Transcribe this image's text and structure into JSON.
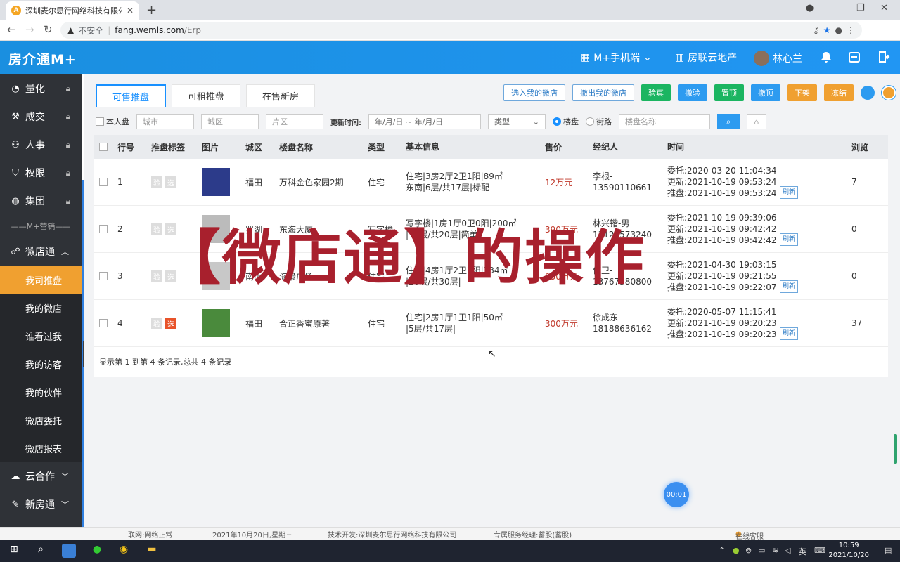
{
  "browser": {
    "tab_title": "深圳麦尔思行网络科技有限公司",
    "new_tab": "+",
    "insecure_label": "不安全",
    "url_host": "fang.wemls.com",
    "url_path": "/Erp"
  },
  "header": {
    "logo": "房介通M+",
    "mobile": "M+手机端",
    "cloud": "房联云地产",
    "user": "林心兰"
  },
  "sidebar": {
    "items": [
      {
        "label": "量化",
        "icon": "chart-pie-icon"
      },
      {
        "label": "成交",
        "icon": "hammer-icon"
      },
      {
        "label": "人事",
        "icon": "people-icon"
      },
      {
        "label": "权限",
        "icon": "shield-icon"
      },
      {
        "label": "集团",
        "icon": "globe-icon"
      }
    ],
    "divider": "M+营销",
    "micro_store": "微店通",
    "subitems": [
      "我司推盘",
      "我的微店",
      "谁看过我",
      "我的访客",
      "我的伙伴",
      "微店委托",
      "微店报表"
    ],
    "cloud": "云合作",
    "newhouse": "新房通"
  },
  "tabs": [
    "可售推盘",
    "可租推盘",
    "在售新房"
  ],
  "actions": {
    "select_in": "选入我的微店",
    "remove_out": "撤出我的微店",
    "verify": "验真",
    "unverify": "撤验",
    "top": "置顶",
    "untop": "撤顶",
    "offline": "下架",
    "freeze": "冻结"
  },
  "filters": {
    "mine": "本人盘",
    "city": "城市",
    "district": "城区",
    "area": "片区",
    "update_label": "更新时间:",
    "date_range": "年/月/日 ~ 年/月/日",
    "type": "类型",
    "radio_building": "楼盘",
    "radio_street": "街路",
    "building_name": "楼盘名称"
  },
  "table": {
    "headers": [
      "行号",
      "推盘标签",
      "图片",
      "城区",
      "楼盘名称",
      "类型",
      "基本信息",
      "售价",
      "经纪人",
      "时间",
      "浏览"
    ],
    "tag_verify": "验",
    "tag_select": "选",
    "refresh": "刷新",
    "rows": [
      {
        "no": "1",
        "city": "福田",
        "name": "万科金色家园2期",
        "type": "住宅",
        "info1": "住宅|3房2厅2卫1阳|89㎡",
        "info2": "东南|6层/共17层|标配",
        "price": "12万元",
        "agent1": "李根-",
        "agent2": "13590110661",
        "t1": "委托:2020-03-20 11:04:34",
        "t2": "更新:2021-10-19 09:53:24",
        "t3": "推盘:2021-10-19 09:53:24",
        "views": "7",
        "thumb": "#2c3b8a",
        "sel": false
      },
      {
        "no": "2",
        "city": "罗湖",
        "name": "东海大厦",
        "type": "写字楼",
        "info1": "写字楼|1房1厅0卫0阳|200㎡",
        "info2": "|15层/共20层|简单",
        "price": "390万元",
        "agent1": "林兴锴-男",
        "agent2": "13129573240",
        "t1": "委托:2021-10-19 09:39:06",
        "t2": "更新:2021-10-19 09:42:42",
        "t3": "推盘:2021-10-19 09:42:42",
        "views": "0",
        "thumb": "#bbbbbb",
        "sel": false
      },
      {
        "no": "3",
        "city": "南山",
        "name": "海景广场",
        "type": "住宅",
        "info1": "住宅|4房1厅2卫2阳|134㎡",
        "info2": "|20层/共30层|",
        "price": "950万元",
        "agent1": "何卫-",
        "agent2": "13767380800",
        "t1": "委托:2021-04-30 19:03:15",
        "t2": "更新:2021-10-19 09:21:55",
        "t3": "推盘:2021-10-19 09:22:07",
        "views": "0",
        "thumb": "#c8c8c8",
        "sel": false
      },
      {
        "no": "4",
        "city": "福田",
        "name": "合正香蜜原著",
        "type": "住宅",
        "info1": "住宅|2房1厅1卫1阳|50㎡",
        "info2": "|5层/共17层|",
        "price": "300万元",
        "agent1": "徐成东-",
        "agent2": "18188636162",
        "t1": "委托:2020-05-07 11:15:41",
        "t2": "更新:2021-10-19 09:20:23",
        "t3": "推盘:2021-10-19 09:20:23",
        "views": "37",
        "thumb": "#4a8a3c",
        "sel": true
      }
    ],
    "summary": "显示第 1 到第 4 条记录,总共 4 条记录"
  },
  "overlay": "【微店通】的操作",
  "timer": "00:01",
  "status": {
    "net": "联网:网络正常",
    "date": "2021年10月20日,星期三",
    "dev": "技术开发:深圳麦尔思行网络科技有限公司",
    "manager": "专属服务经理:蓄股(蓄股)",
    "online": "在线客服"
  },
  "taskbar": {
    "ime": "英",
    "time": "10:59",
    "date": "2021/10/20"
  }
}
